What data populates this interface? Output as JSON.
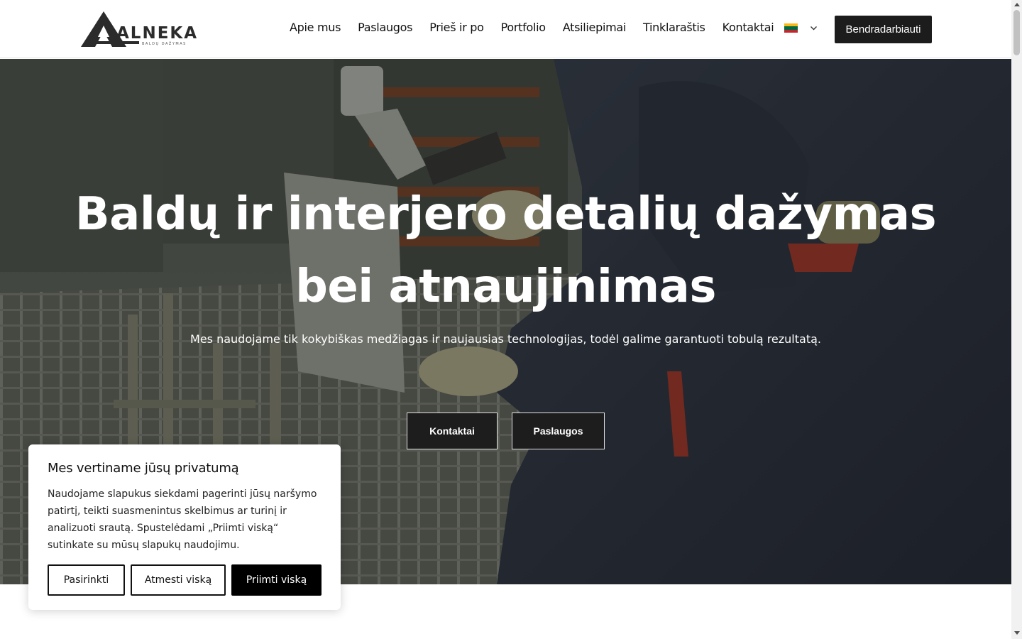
{
  "header": {
    "logo": {
      "wordmark": "ALNEKA",
      "tagline": "BALDŲ DAŽYMAS"
    },
    "nav": [
      {
        "label": "Apie mus"
      },
      {
        "label": "Paslaugos"
      },
      {
        "label": "Prieš ir po"
      },
      {
        "label": "Portfolio"
      },
      {
        "label": "Atsiliepimai"
      },
      {
        "label": "Tinklaraštis"
      },
      {
        "label": "Kontaktai"
      }
    ],
    "language": {
      "flag": "lithuania-flag-icon",
      "colors": [
        "#FDB913",
        "#006A44",
        "#C1272D"
      ]
    },
    "cta_label": "Bendradarbiauti"
  },
  "hero": {
    "title": "Baldų ir interjero detalių dažymas bei atnaujinimas",
    "subtitle": "Mes naudojame tik kokybiškas medžiagas ir naujausias technologijas, todėl galime garantuoti tobulą rezultatą.",
    "buttons": [
      {
        "label": "Kontaktai"
      },
      {
        "label": "Paslaugos"
      }
    ]
  },
  "cookie_banner": {
    "title": "Mes vertiname jūsų privatumą",
    "text": "Naudojame slapukus siekdami pagerinti jūsų naršymo patirtį, teikti suasmenintus skelbimus ar turinį ir analizuoti srautą. Spustelėdami „Priimti viską“ sutinkate su mūsų slapukų naudojimu.",
    "buttons": {
      "customize": "Pasirinkti",
      "reject": "Atmesti viską",
      "accept": "Priimti viską"
    }
  },
  "colors": {
    "dark": "#1c1c1c",
    "accent_red": "#c0392b"
  }
}
